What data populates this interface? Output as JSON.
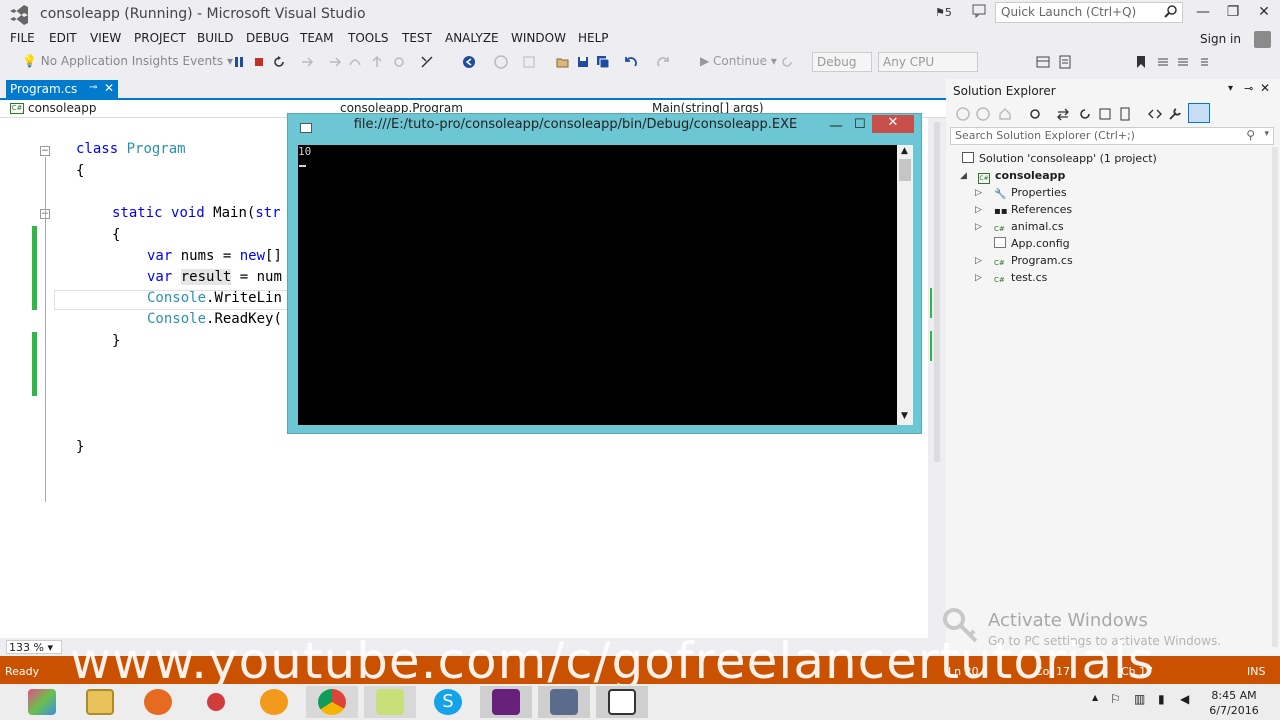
{
  "window": {
    "title": "consoleapp (Running) - Microsoft Visual Studio",
    "flag_count": "5",
    "quick_launch_placeholder": "Quick Launch (Ctrl+Q)"
  },
  "menu": [
    "FILE",
    "EDIT",
    "VIEW",
    "PROJECT",
    "BUILD",
    "DEBUG",
    "TEAM",
    "TOOLS",
    "TEST",
    "ANALYZE",
    "WINDOW",
    "HELP"
  ],
  "signin": "Sign in",
  "toolbar": {
    "insights": "No Application Insights Events",
    "continue": "Continue",
    "config": "Debug",
    "platform": "Any CPU"
  },
  "editor": {
    "tab": "Program.cs",
    "nav_project": "consoleapp",
    "nav_class": "consoleapp.Program",
    "nav_member": "Main(string[] args)",
    "zoom": "133 %"
  },
  "console": {
    "title": "file:///E:/tuto-pro/consoleapp/consoleapp/bin/Debug/consoleapp.EXE",
    "output": "10"
  },
  "solution_explorer": {
    "header": "Solution Explorer",
    "search_placeholder": "Search Solution Explorer (Ctrl+;)",
    "solution": "Solution 'consoleapp' (1 project)",
    "project": "consoleapp",
    "items": [
      "Properties",
      "References",
      "animal.cs",
      "App.config",
      "Program.cs",
      "test.cs"
    ]
  },
  "watermark": {
    "line1": "Activate Windows",
    "line2": "Go to PC settings to activate Windows."
  },
  "status": {
    "ready": "Ready",
    "ln": "Ln 20",
    "col": "Col 17",
    "ch": "Ch 17",
    "mode": "INS"
  },
  "overlay_text": "www.youtube.com/c/gofreelancertutorials",
  "clock": {
    "time": "8:45 AM",
    "date": "6/7/2016"
  },
  "colors": {
    "accent": "#007acc",
    "status_bar": "#ca5100",
    "console_frame": "#6dc6d3"
  }
}
